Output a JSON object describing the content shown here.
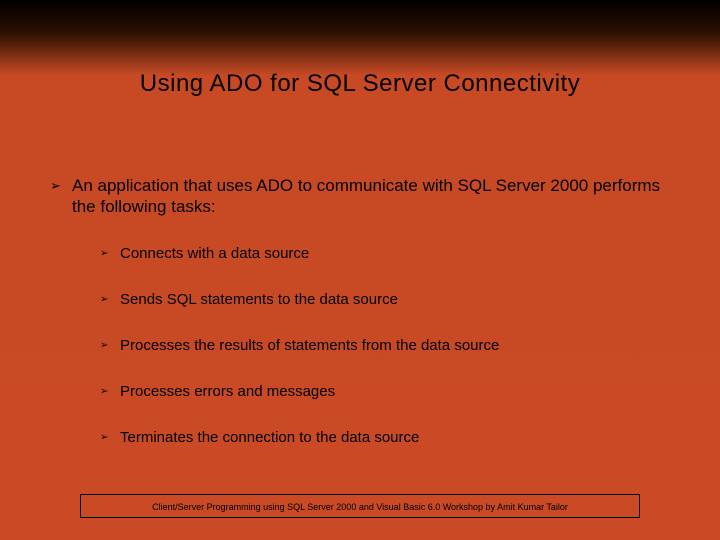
{
  "title": "Using ADO for SQL Server Connectivity",
  "intro": "An application that uses ADO to communicate with SQL Server 2000 performs the following tasks:",
  "bullets": [
    "Connects with a data source",
    "Sends SQL statements to the data source",
    "Processes the results of statements from the data source",
    "Processes errors and messages",
    "Terminates the connection to the data source"
  ],
  "footer": "Client/Server Programming using SQL Server 2000 and Visual Basic 6.0 Workshop by Amit Kumar Tailor",
  "bullet_glyph": "➢"
}
